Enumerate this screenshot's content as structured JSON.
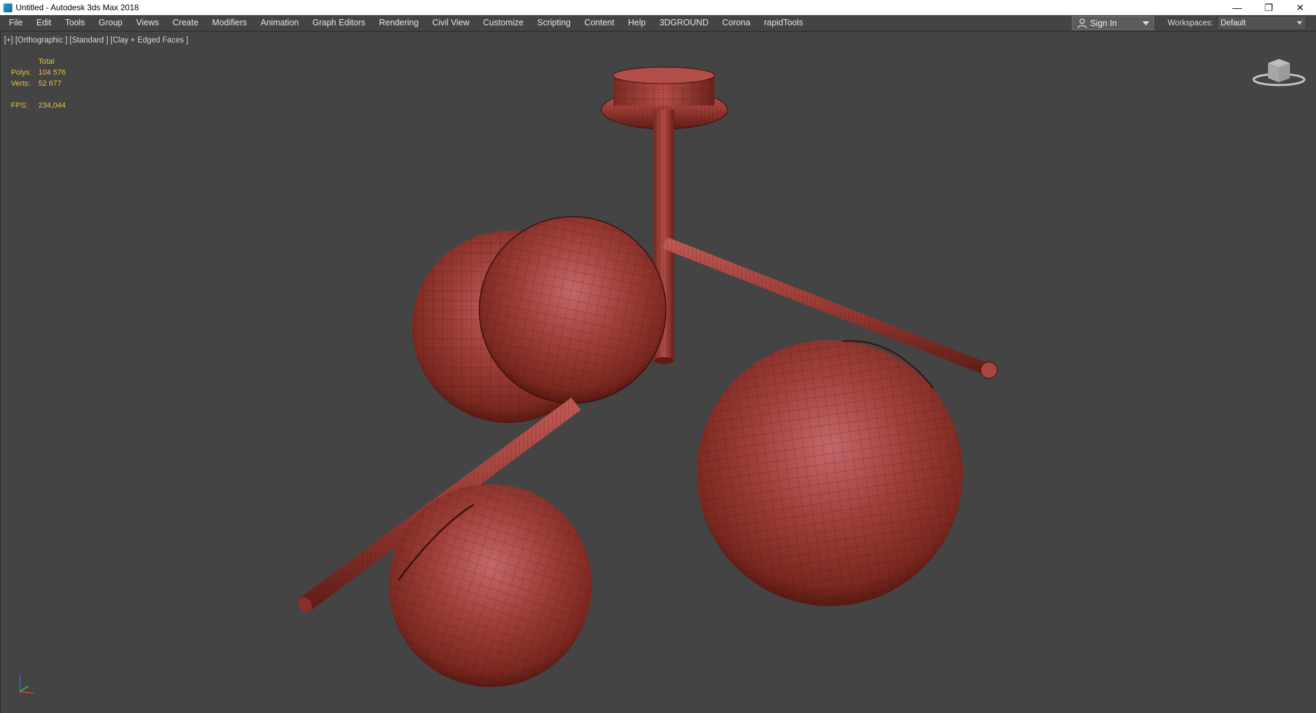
{
  "window": {
    "title": "Untitled - Autodesk 3ds Max 2018",
    "controls": [
      "minimize-icon",
      "restore-icon",
      "close-icon"
    ]
  },
  "menu": {
    "items": [
      "File",
      "Edit",
      "Tools",
      "Group",
      "Views",
      "Create",
      "Modifiers",
      "Animation",
      "Graph Editors",
      "Rendering",
      "Civil View",
      "Customize",
      "Scripting",
      "Content",
      "Help",
      "3DGROUND",
      "Corona",
      "rapidTools"
    ],
    "sign_in": "Sign In",
    "workspaces_label": "Workspaces:",
    "workspace_value": "Default"
  },
  "viewport": {
    "label": "[+] [Orthographic ] [Standard ] [Clay + Edged Faces ]",
    "stats": {
      "header": "Total",
      "polys_label": "Polys:",
      "polys_value": "104 576",
      "verts_label": "Verts:",
      "verts_value": "52 677",
      "fps_label": "FPS:",
      "fps_value": "234,044"
    },
    "viewcube_icon": "viewcube-icon",
    "axis_icon": "axis-tripod-icon",
    "model_color": "#a84038"
  },
  "colors": {
    "ui_background": "#444444",
    "stats_text": "#e8c23a",
    "title_bar": "#ffffff"
  }
}
